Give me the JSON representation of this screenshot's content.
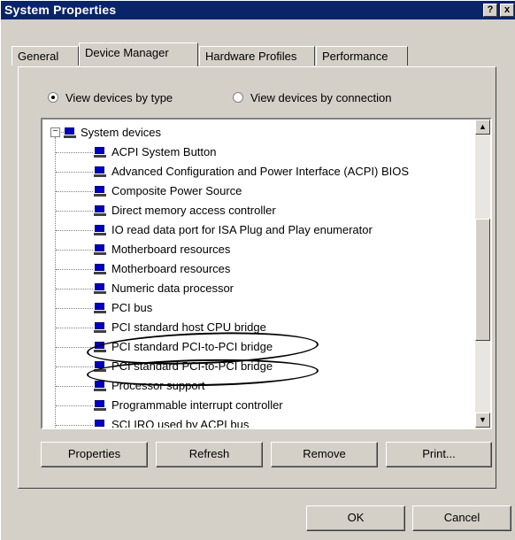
{
  "window": {
    "title": "System Properties",
    "help_button": "?",
    "close_button": "x"
  },
  "tabs": [
    {
      "label": "General",
      "active": false
    },
    {
      "label": "Device Manager",
      "active": true
    },
    {
      "label": "Hardware Profiles",
      "active": false
    },
    {
      "label": "Performance",
      "active": false
    }
  ],
  "view_options": {
    "by_type": {
      "label": "View devices by type",
      "selected": true
    },
    "by_connection": {
      "label": "View devices by connection",
      "selected": false
    }
  },
  "device_tree": {
    "category": "System devices",
    "expand_symbol": "−",
    "items": [
      "ACPI System Button",
      "Advanced Configuration and Power Interface (ACPI) BIOS",
      "Composite Power Source",
      "Direct memory access controller",
      "IO read data port for ISA Plug and Play enumerator",
      "Motherboard resources",
      "Motherboard resources",
      "Numeric data processor",
      "PCI bus",
      "PCI standard host CPU bridge",
      "PCI standard PCI-to-PCI bridge",
      "PCI standard PCI-to-PCI bridge",
      "Processor support",
      "Programmable interrupt controller",
      "SCI IRQ used by ACPI bus"
    ],
    "highlighted_items": [
      10,
      11
    ]
  },
  "scroll": {
    "up": "▲",
    "down": "▼"
  },
  "buttons": {
    "properties": "Properties",
    "refresh": "Refresh",
    "remove": "Remove",
    "print": "Print...",
    "ok": "OK",
    "cancel": "Cancel"
  }
}
